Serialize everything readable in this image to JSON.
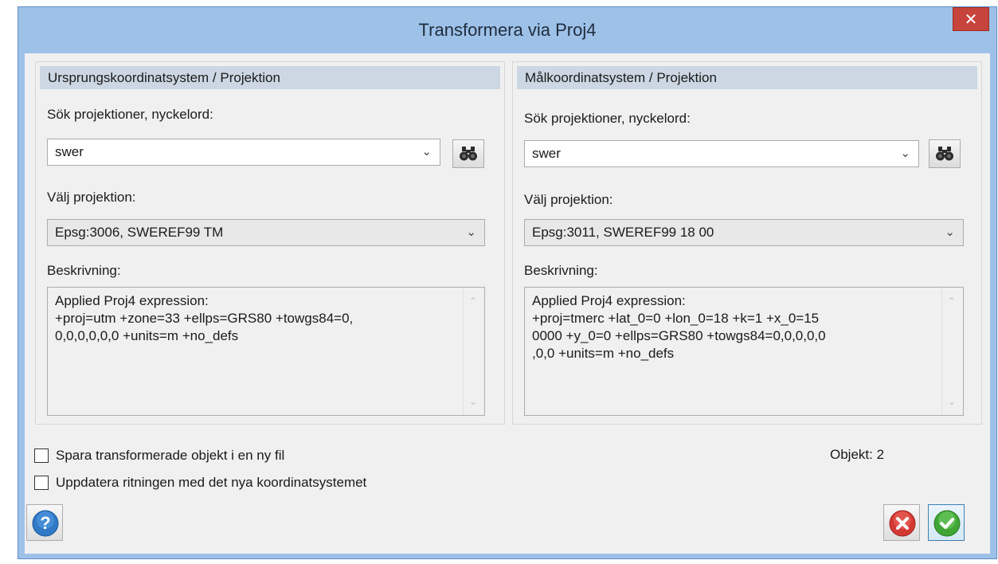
{
  "window": {
    "title": "Transformera via Proj4",
    "close_glyph": "✕"
  },
  "source": {
    "header": "Ursprungskoordinatsystem / Projektion",
    "search_label": "Sök projektioner, nyckelord:",
    "search_value": "swer",
    "projection_label": "Välj projektion:",
    "projection_value": "Epsg:3006, SWEREF99 TM",
    "description_label": "Beskrivning:",
    "description": "Applied Proj4 expression:\n+proj=utm +zone=33 +ellps=GRS80 +towgs84=0,\n0,0,0,0,0,0 +units=m +no_defs"
  },
  "target": {
    "header": "Målkoordinatsystem / Projektion",
    "search_label": "Sök projektioner, nyckelord:",
    "search_value": "swer",
    "projection_label": "Välj projektion:",
    "projection_value": "Epsg:3011, SWEREF99 18 00",
    "description_label": "Beskrivning:",
    "description": "Applied Proj4 expression:\n+proj=tmerc +lat_0=0 +lon_0=18 +k=1 +x_0=15\n0000 +y_0=0 +ellps=GRS80 +towgs84=0,0,0,0,0\n,0,0 +units=m +no_defs"
  },
  "options": {
    "save_new_file": {
      "label": "Spara transformerade objekt i en ny fil",
      "checked": false
    },
    "update_drawing": {
      "label": "Uppdatera ritningen med det nya koordinatsystemet",
      "checked": false
    }
  },
  "status": {
    "objekt": "Objekt: 2"
  },
  "icons": {
    "help": "help-icon",
    "cancel": "cancel-icon",
    "ok": "ok-icon",
    "search": "binoculars-icon",
    "dropdown": "chevron-down-icon"
  },
  "colors": {
    "title_bar": "#9ec1e8",
    "close": "#c7443c",
    "group_header": "#ccd7e3",
    "ok_green": "#3fa535",
    "cancel_red": "#d23a33",
    "help_blue": "#2f79c6"
  }
}
